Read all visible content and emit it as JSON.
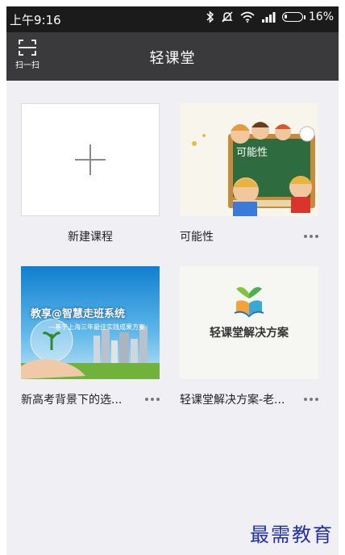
{
  "status_bar": {
    "time": "上午9:16",
    "battery_percent": "16%",
    "battery_level": 0.16
  },
  "nav": {
    "title": "轻课堂",
    "scan_label": "扫一扫"
  },
  "cards": [
    {
      "title": "新建课程",
      "type": "new"
    },
    {
      "title": "可能性",
      "thumb_heading": "可能性"
    },
    {
      "title": "新高考背景下的选...",
      "thumb_heading": "教享@智慧走班系统",
      "thumb_sub": "—基于上海三年最佳实践成果方案"
    },
    {
      "title": "轻课堂解决方案-老...",
      "thumb_heading": "轻课堂解决方案"
    }
  ],
  "watermark": "最需教育",
  "colors": {
    "status_bg": "#1b1b1b",
    "nav_bg": "#3a3a3d",
    "page_bg": "#efeff4",
    "chalkboard": "#2e6b3e",
    "board_frame": "#c98a3c"
  }
}
